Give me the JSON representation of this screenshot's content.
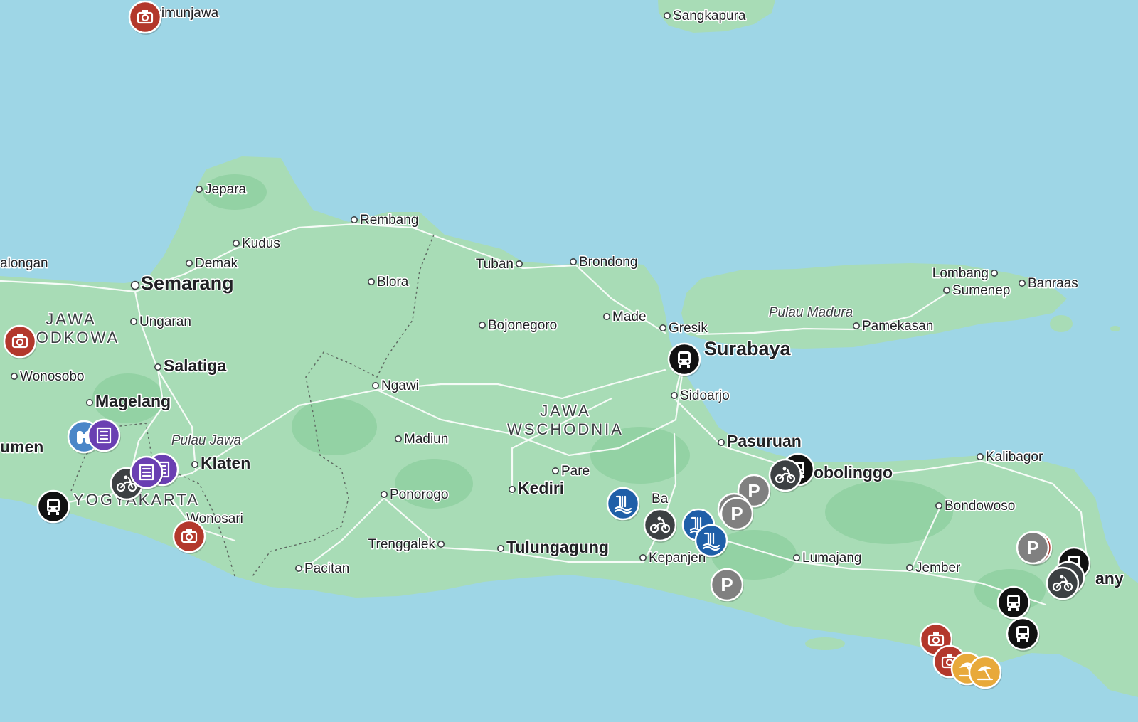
{
  "colors": {
    "sea": "#9ed6e6",
    "land": "#a8dcb6",
    "land_dark": "#93d2a4",
    "road": "#ffffff",
    "camera_pin": "#b3382c",
    "bus_pin": "#111111",
    "motorbike_pin": "#3c4043",
    "parking_pin": "#808080",
    "waterfall_pin": "#1f5fa8",
    "binoculars_pin": "#4a86c8",
    "hotel_pin": "#6a3fb2",
    "beach_pin": "#e8a93a"
  },
  "places": [
    {
      "id": "karimunjawa",
      "label": "arimunjawa",
      "kind": "town",
      "dot": false
    },
    {
      "id": "sangkapura",
      "label": "Sangkapura",
      "kind": "town",
      "dot": true
    },
    {
      "id": "jepara",
      "label": "Jepara",
      "kind": "town",
      "dot": true
    },
    {
      "id": "rembang",
      "label": "Rembang",
      "kind": "town",
      "dot": true
    },
    {
      "id": "kudus",
      "label": "Kudus",
      "kind": "town",
      "dot": true
    },
    {
      "id": "demak",
      "label": "Demak",
      "kind": "town",
      "dot": true
    },
    {
      "id": "pekalongan",
      "label": "alongan",
      "kind": "town",
      "dot": false
    },
    {
      "id": "semarang",
      "label": "Semarang",
      "kind": "city",
      "dot": true
    },
    {
      "id": "blora",
      "label": "Blora",
      "kind": "town",
      "dot": true
    },
    {
      "id": "tuban",
      "label": "Tuban",
      "kind": "town",
      "dot": true
    },
    {
      "id": "brondong",
      "label": "Brondong",
      "kind": "town",
      "dot": true
    },
    {
      "id": "lombang",
      "label": "Lombang",
      "kind": "town",
      "dot": true
    },
    {
      "id": "sumenep",
      "label": "Sumenep",
      "kind": "town",
      "dot": true
    },
    {
      "id": "banraas",
      "label": "Banraas",
      "kind": "town",
      "dot": true
    },
    {
      "id": "ungaran",
      "label": "Ungaran",
      "kind": "town",
      "dot": true
    },
    {
      "id": "made",
      "label": "Made",
      "kind": "town",
      "dot": true
    },
    {
      "id": "bojonegoro",
      "label": "Bojonegoro",
      "kind": "town",
      "dot": true
    },
    {
      "id": "gresik",
      "label": "Gresik",
      "kind": "town",
      "dot": true
    },
    {
      "id": "pamekasan",
      "label": "Pamekasan",
      "kind": "town",
      "dot": true
    },
    {
      "id": "surabaya",
      "label": "Surabaya",
      "kind": "city",
      "dot": false
    },
    {
      "id": "salatiga",
      "label": "Salatiga",
      "kind": "city-small",
      "dot": true
    },
    {
      "id": "wonosobo",
      "label": "Wonosobo",
      "kind": "town",
      "dot": true
    },
    {
      "id": "ngawi",
      "label": "Ngawi",
      "kind": "town",
      "dot": true
    },
    {
      "id": "sidoarjo",
      "label": "Sidoarjo",
      "kind": "town",
      "dot": true
    },
    {
      "id": "magelang",
      "label": "Magelang",
      "kind": "city-small",
      "dot": true
    },
    {
      "id": "madiun",
      "label": "Madiun",
      "kind": "town",
      "dot": true
    },
    {
      "id": "pasuruan",
      "label": "Pasuruan",
      "kind": "city-small",
      "dot": true
    },
    {
      "id": "kalibagor",
      "label": "Kalibagor",
      "kind": "town",
      "dot": true
    },
    {
      "id": "purwokerto",
      "label": "umen",
      "kind": "city-small",
      "dot": false
    },
    {
      "id": "klaten",
      "label": "Klaten",
      "kind": "city-small",
      "dot": true
    },
    {
      "id": "pare",
      "label": "Pare",
      "kind": "town",
      "dot": true
    },
    {
      "id": "probolinggo",
      "label": "robolinggo",
      "kind": "city-small",
      "dot": false
    },
    {
      "id": "kediri",
      "label": "Kediri",
      "kind": "city-small",
      "dot": true
    },
    {
      "id": "ponorogo",
      "label": "Ponorogo",
      "kind": "town",
      "dot": true
    },
    {
      "id": "batu",
      "label": "Ba",
      "kind": "town",
      "dot": false
    },
    {
      "id": "bondowoso",
      "label": "Bondowoso",
      "kind": "town",
      "dot": true
    },
    {
      "id": "wonosari",
      "label": "Wonosari",
      "kind": "town",
      "dot": false
    },
    {
      "id": "trenggalek",
      "label": "Trenggalek",
      "kind": "town",
      "dot": true
    },
    {
      "id": "tulungagung",
      "label": "Tulungagung",
      "kind": "city-small",
      "dot": true
    },
    {
      "id": "kepanjen",
      "label": "Kepanjen",
      "kind": "town",
      "dot": true
    },
    {
      "id": "lumajang",
      "label": "Lumajang",
      "kind": "town",
      "dot": true
    },
    {
      "id": "jember",
      "label": "Jember",
      "kind": "town",
      "dot": true
    },
    {
      "id": "pacitan",
      "label": "Pacitan",
      "kind": "town",
      "dot": true
    },
    {
      "id": "banyuwangi",
      "label": "any",
      "kind": "city-small",
      "dot": false
    }
  ],
  "regions": [
    {
      "id": "jawa-tengah",
      "lines": [
        "JAWA",
        "RODKOWA"
      ]
    },
    {
      "id": "jawa-timur",
      "lines": [
        "JAWA",
        "WSCHODNIA"
      ]
    },
    {
      "id": "yogyakarta",
      "lines": [
        "YOGYAKARTA"
      ]
    }
  ],
  "islands": [
    {
      "id": "pulau-madura",
      "label": "Pulau Madura"
    },
    {
      "id": "pulau-jawa",
      "label": "Pulau Jawa"
    }
  ],
  "pins": [
    {
      "type": "camera",
      "icon": "camera-icon"
    },
    {
      "type": "camera",
      "icon": "camera-icon"
    },
    {
      "type": "camera",
      "icon": "camera-icon"
    },
    {
      "type": "camera",
      "icon": "camera-icon"
    },
    {
      "type": "camera",
      "icon": "camera-icon"
    },
    {
      "type": "camera",
      "icon": "camera-icon"
    },
    {
      "type": "bus",
      "icon": "bus-icon"
    },
    {
      "type": "bus",
      "icon": "bus-icon"
    },
    {
      "type": "bus",
      "icon": "bus-icon"
    },
    {
      "type": "bus",
      "icon": "bus-icon"
    },
    {
      "type": "bus",
      "icon": "bus-icon"
    },
    {
      "type": "bus",
      "icon": "bus-icon"
    },
    {
      "type": "motorbike",
      "icon": "motorbike-icon"
    },
    {
      "type": "motorbike",
      "icon": "motorbike-icon"
    },
    {
      "type": "motorbike",
      "icon": "motorbike-icon"
    },
    {
      "type": "motorbike",
      "icon": "motorbike-icon"
    },
    {
      "type": "motorbike",
      "icon": "motorbike-icon"
    },
    {
      "type": "parking",
      "icon": "parking-icon",
      "letter": "P"
    },
    {
      "type": "parking",
      "icon": "parking-icon",
      "letter": "P"
    },
    {
      "type": "parking",
      "icon": "parking-icon",
      "letter": "P"
    },
    {
      "type": "parking",
      "icon": "parking-icon",
      "letter": "P"
    },
    {
      "type": "parking",
      "icon": "parking-icon",
      "letter": "P"
    },
    {
      "type": "waterfall",
      "icon": "waterfall-icon"
    },
    {
      "type": "waterfall",
      "icon": "waterfall-icon"
    },
    {
      "type": "waterfall",
      "icon": "waterfall-icon"
    },
    {
      "type": "binoculars",
      "icon": "binoculars-icon"
    },
    {
      "type": "hotel",
      "icon": "hotel-icon"
    },
    {
      "type": "hotel",
      "icon": "hotel-icon"
    },
    {
      "type": "hotel",
      "icon": "hotel-icon"
    },
    {
      "type": "beach",
      "icon": "beach-umbrella-icon"
    },
    {
      "type": "beach",
      "icon": "beach-umbrella-icon"
    }
  ]
}
